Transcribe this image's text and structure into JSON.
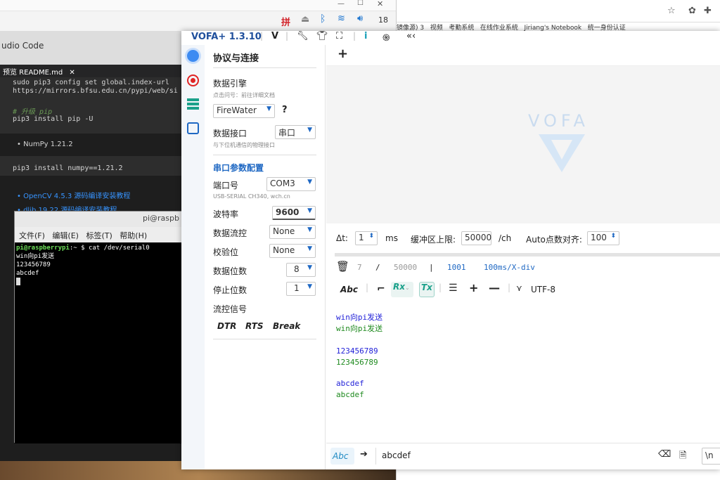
{
  "pi_bar": {
    "input_method": "拼",
    "clock_number": "18"
  },
  "browser": {
    "bookmarks": [
      "镜像源) 3",
      "视频",
      "考勤系统",
      "在线作业系统",
      "Jiriang's Notebook",
      "统一身份认证"
    ]
  },
  "vscode": {
    "title": "udio Code",
    "tab": "预览 README.md",
    "lines": [
      "sudo pip3 config set global.index-url",
      "https://mirrors.bfsu.edu.cn/pypi/web/si"
    ],
    "comment": "# 升级 pip",
    "cmd1": "pip3 install pip -U",
    "bullet1": "NumPy 1.21.2",
    "cmd2": "pip3 install numpy==1.21.2",
    "bullet2": "OpenCV 4.5.3 源码编译安装教程",
    "bullet3": "dlib 19.22 源码编译安装教程"
  },
  "terminal": {
    "title": "pi@raspb",
    "menu": [
      "文件(F)",
      "编辑(E)",
      "标签(T)",
      "帮助(H)"
    ],
    "prompt_user": "pi@raspberrypi",
    "prompt_rest": ":~ $ cat /dev/serial0",
    "output": [
      "win向pi发送",
      "123456789",
      "abcdef"
    ]
  },
  "vofa": {
    "title": "VOFA+ 1.3.10",
    "panel": {
      "heading": "协议与连接",
      "engine_label": "数据引擎",
      "engine_hint": "点击问号：前往详细文档",
      "engine_value": "FireWater",
      "question": "?",
      "interface_label": "数据接口",
      "interface_value": "串口",
      "interface_hint": "与下位机通信的物理接口",
      "serial_heading": "串口参数配置",
      "port_label": "端口号",
      "port_value": "COM3",
      "port_hint": "USB-SERIAL CH340, wch.cn",
      "baud_label": "波特率",
      "baud_value": "9600",
      "flow_label": "数据流控",
      "flow_value": "None",
      "parity_label": "校验位",
      "parity_value": "None",
      "databits_label": "数据位数",
      "databits_value": "8",
      "stopbits_label": "停止位数",
      "stopbits_value": "1",
      "signal_label": "流控信号",
      "dtr": "DTR",
      "rts": "RTS",
      "brk": "Break"
    },
    "main": {
      "add": "+",
      "logo_text": "VOFA",
      "dt_label": "Δt:",
      "dt_value": "1",
      "dt_unit": "ms",
      "buffer_label": "缓冲区上限:",
      "buffer_value": "50000",
      "buffer_unit": "/ch",
      "auto_label": "Auto点数对齐:",
      "auto_value": "100",
      "stat_a": "7",
      "stat_slash": "/",
      "stat_b": "50000",
      "stat_bar": "|",
      "stat_c": "1001",
      "stat_d": "100ms/X-div",
      "abc": "Abc",
      "rx": "Rx",
      "tx": "Tx",
      "encoding": "UTF-8",
      "log": [
        {
          "text": "win向pi发送",
          "color": "#2222d8"
        },
        {
          "text": "win向pi发送",
          "color": "#1f8a1f"
        },
        {
          "text": "",
          "color": "#000"
        },
        {
          "text": "123456789",
          "color": "#2222d8"
        },
        {
          "text": "123456789",
          "color": "#1f8a1f"
        },
        {
          "text": "",
          "color": "#000"
        },
        {
          "text": "abcdef",
          "color": "#2222d8"
        },
        {
          "text": "abcdef",
          "color": "#1f8a1f"
        }
      ],
      "send_abc": "Abc",
      "send_value": "abcdef",
      "newline": "\\n"
    }
  }
}
